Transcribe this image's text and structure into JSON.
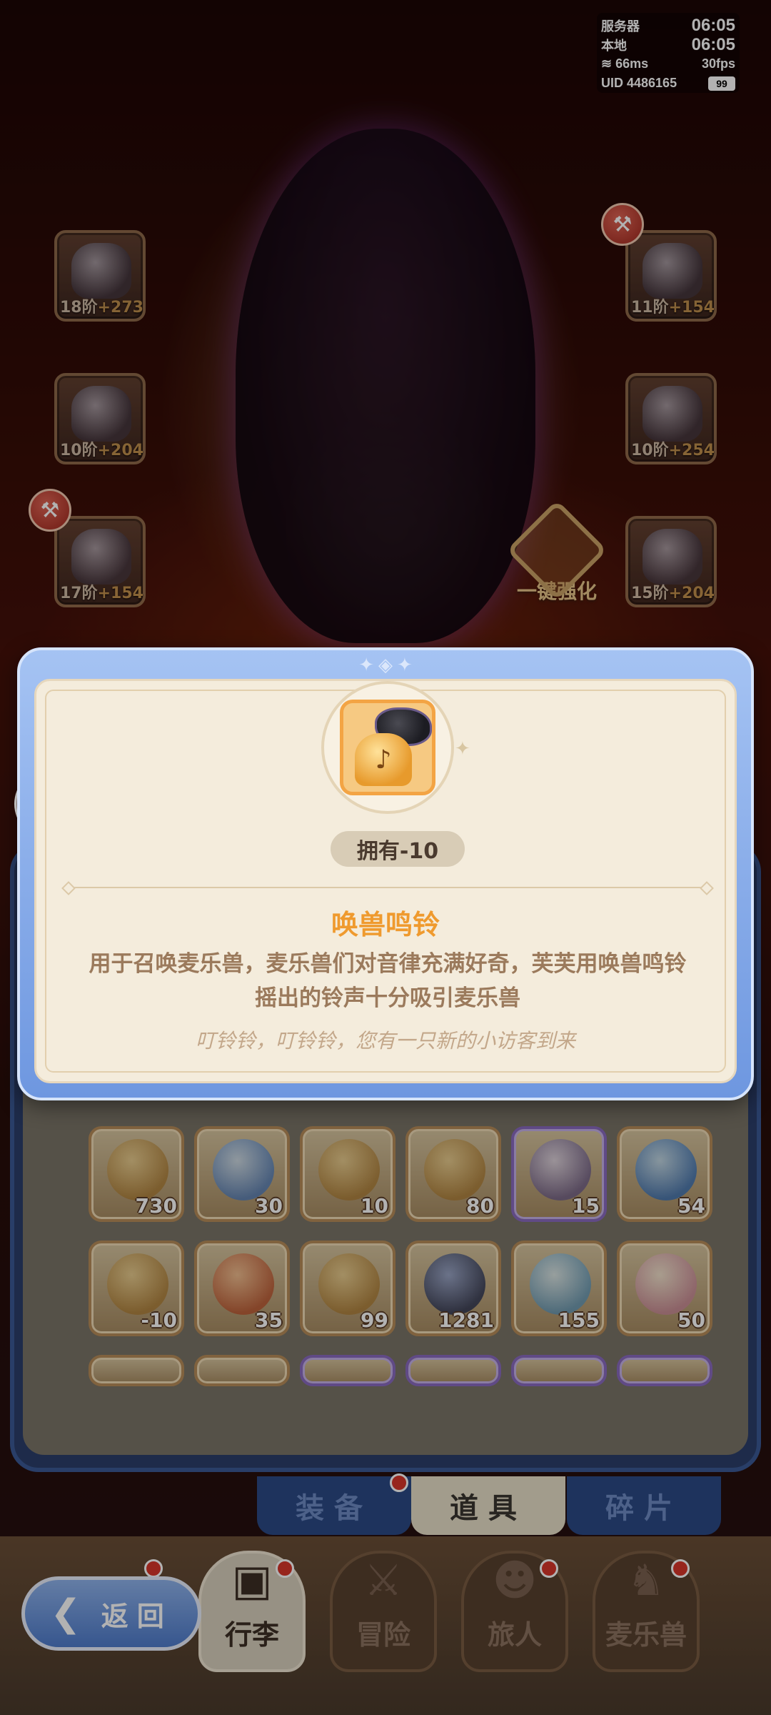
{
  "status": {
    "server_label": "服务器",
    "server_time": "06:05",
    "local_label": "本地",
    "local_time": "06:05",
    "ping": "66ms",
    "fps": "30fps",
    "uid": "UID 4486165",
    "battery": "99"
  },
  "equipment": {
    "slots": [
      {
        "tier": "18阶",
        "plus": "+273"
      },
      {
        "tier": "10阶",
        "plus": "+204"
      },
      {
        "tier": "17阶",
        "plus": "+154"
      },
      {
        "tier": "11阶",
        "plus": "+154"
      },
      {
        "tier": "10阶",
        "plus": "+254"
      },
      {
        "tier": "15阶",
        "plus": "+204"
      }
    ],
    "enhance_label": "一键强化"
  },
  "modal": {
    "owned": "拥有-10",
    "item_name": "唤兽鸣铃",
    "description": "用于召唤麦乐兽，麦乐兽们对音律充满好奇，芙芙用唤兽鸣铃摇出的铃声十分吸引麦乐兽",
    "flavor": "叮铃铃，叮铃铃，您有一只新的小访客到来"
  },
  "inventory": {
    "row1": [
      "730",
      "30",
      "10",
      "80",
      "15",
      "54"
    ],
    "row2": [
      "-10",
      "35",
      "99",
      "1281",
      "155",
      "50"
    ]
  },
  "subtabs": {
    "equipment": "装备",
    "items": "道具",
    "fragments": "碎片"
  },
  "nav": {
    "back": "返回",
    "bag": "行李",
    "adventure": "冒险",
    "traveler": "旅人",
    "beast": "麦乐兽"
  },
  "colors": {
    "accent_orange": "#ef9a2e",
    "modal_blue": "#6e97e0",
    "card_bg": "#f4ecdc",
    "badge_red": "#d9352a"
  }
}
